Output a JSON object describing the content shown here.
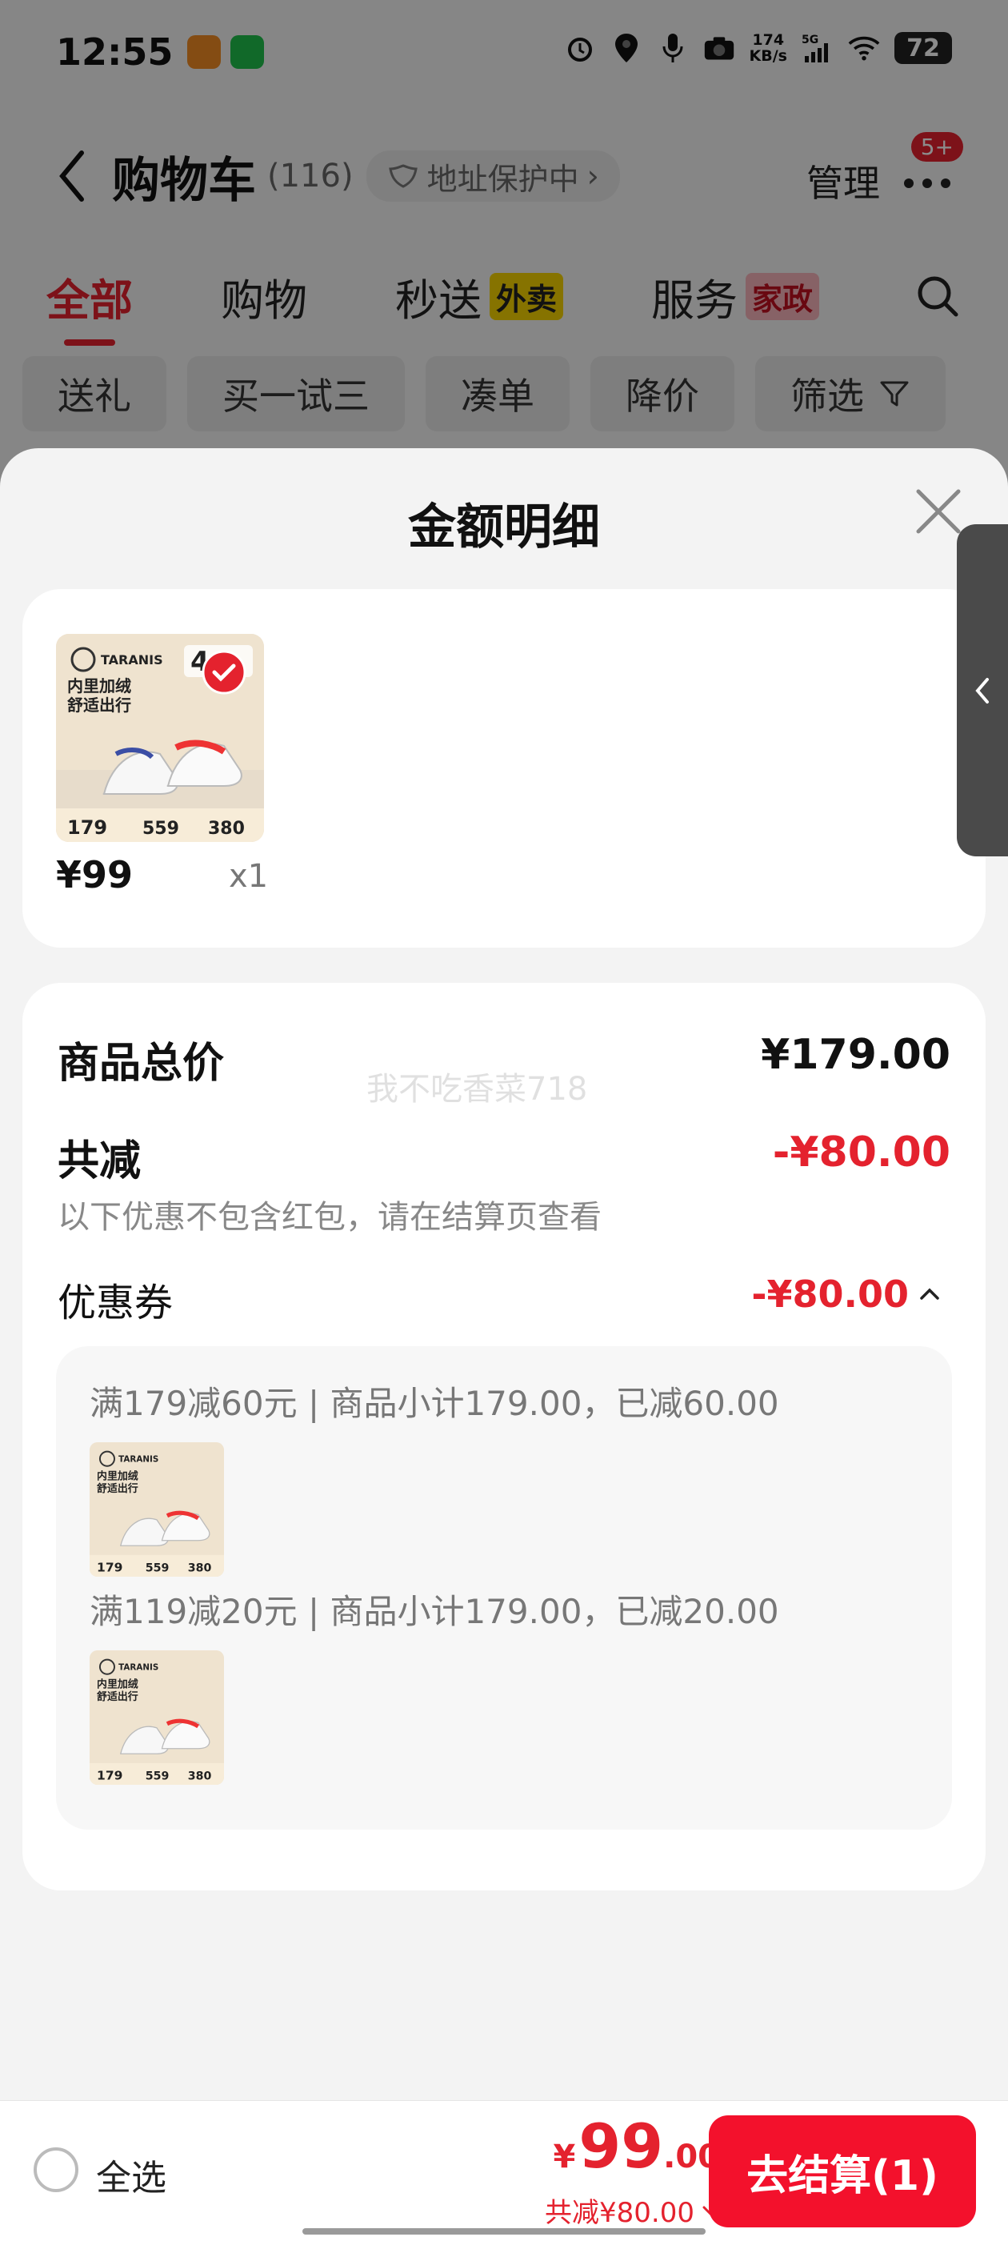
{
  "status_bar": {
    "time": "12:55",
    "speed_value": "174",
    "speed_unit": "KB/s",
    "network": "5G",
    "battery": "72"
  },
  "nav": {
    "title": "购物车",
    "count": "(116)",
    "address_protect": "地址保护中",
    "manage": "管理",
    "badge": "5+"
  },
  "tabs": [
    {
      "label": "全部"
    },
    {
      "label": "购物"
    },
    {
      "label": "秒送",
      "tag": "外卖"
    },
    {
      "label": "服务",
      "tag": "家政"
    }
  ],
  "chips": [
    "送礼",
    "买一试三",
    "凑单",
    "降价",
    "筛选"
  ],
  "sheet": {
    "title": "金额明细",
    "item": {
      "price": "¥99",
      "qty": "x1",
      "image": {
        "brand": "TARANIS",
        "slogan1": "内里加绒",
        "slogan2": "舒适出行",
        "p1": "179",
        "p2": "559",
        "p3": "380"
      }
    },
    "summary": {
      "total_label": "商品总价",
      "total_value": "¥179.00",
      "discount_label": "共减",
      "discount_value": "-¥80.00",
      "note": "以下优惠不包含红包，请在结算页查看",
      "coupon_label": "优惠券",
      "coupon_value": "-¥80.00",
      "watermark": "我不吃香菜718",
      "coupons": [
        {
          "text": "满179减60元 | 商品小计179.00，已减60.00"
        },
        {
          "text": "满119减20元 | 商品小计179.00，已减20.00"
        }
      ]
    }
  },
  "bottom": {
    "select_all": "全选",
    "currency": "¥",
    "total_int": "99",
    "total_dec": ".00",
    "saving": "共减¥80.00",
    "checkout": "去结算(1)"
  }
}
